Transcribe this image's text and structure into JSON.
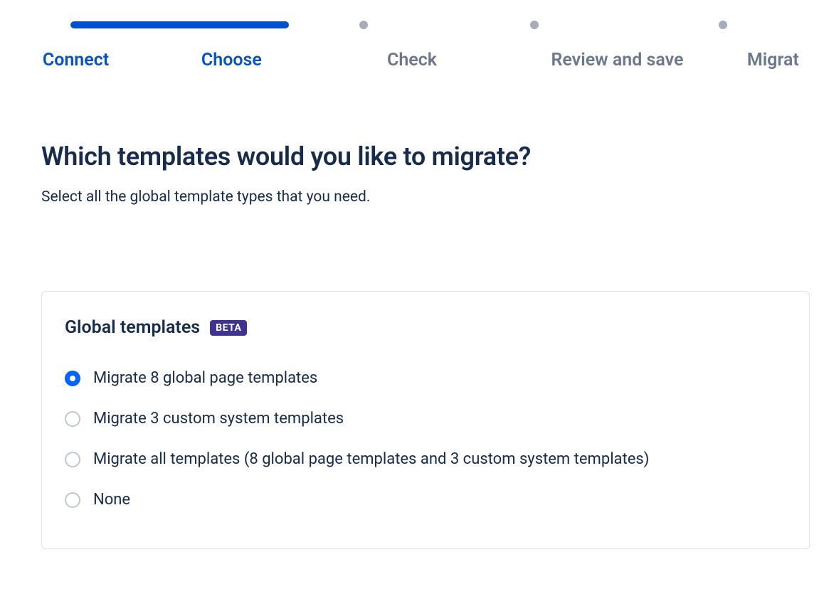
{
  "stepper": {
    "steps": [
      {
        "label": "Connect",
        "state": "active"
      },
      {
        "label": "Choose",
        "state": "active"
      },
      {
        "label": "Check",
        "state": "pending"
      },
      {
        "label": "Review and save",
        "state": "pending"
      },
      {
        "label": "Migrat",
        "state": "pending"
      }
    ],
    "active_index": 1
  },
  "page": {
    "title": "Which templates would you like to migrate?",
    "subtitle": "Select all the global template types that you need."
  },
  "card": {
    "title": "Global templates",
    "badge": "BETA",
    "options": [
      {
        "label": "Migrate 8 global page templates",
        "selected": true
      },
      {
        "label": "Migrate 3 custom system templates",
        "selected": false
      },
      {
        "label": "Migrate all templates (8 global page templates and 3 custom system templates)",
        "selected": false
      },
      {
        "label": "None",
        "selected": false
      }
    ]
  }
}
